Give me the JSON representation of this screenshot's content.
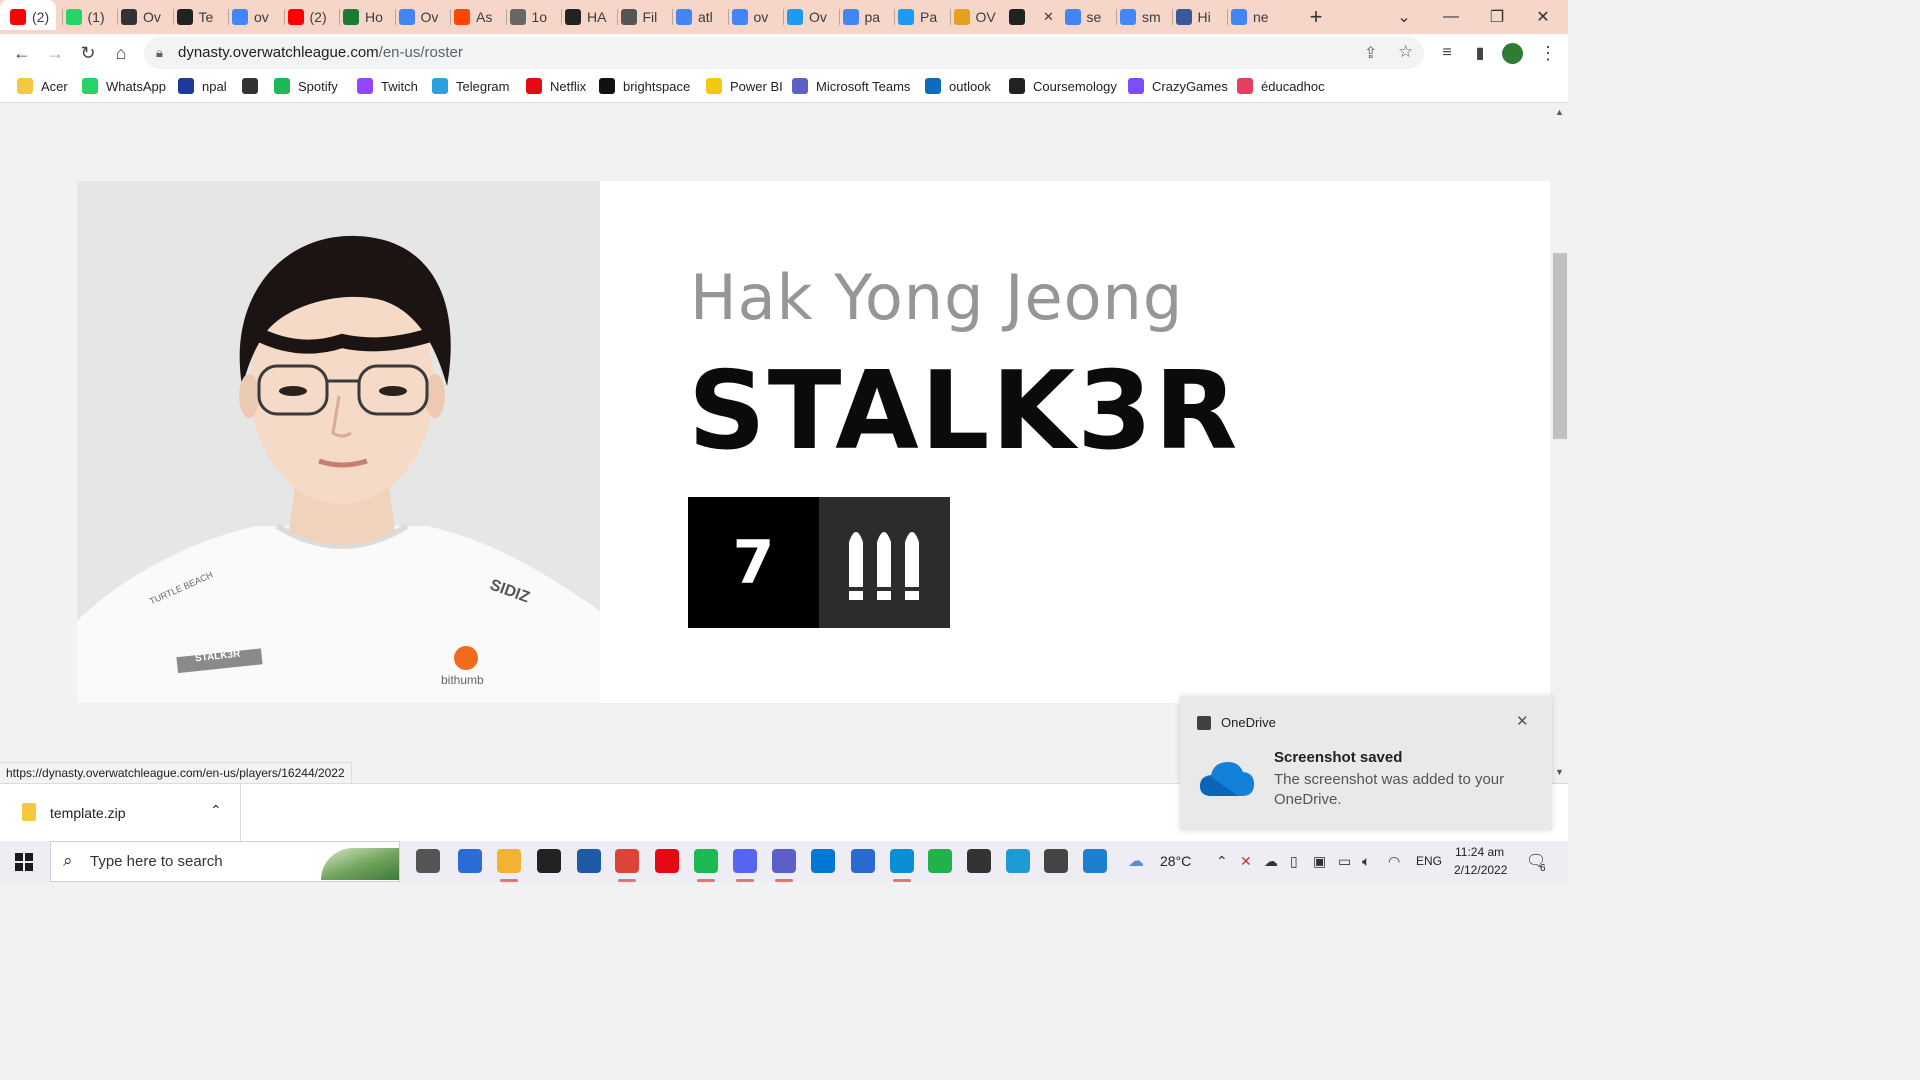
{
  "browser": {
    "tabs": [
      {
        "title": "(2)",
        "icon": "youtube-icon",
        "color": "#ff0000"
      },
      {
        "title": "(1)",
        "icon": "whatsapp-icon",
        "color": "#25d366"
      },
      {
        "title": "Ov",
        "icon": "overwatch-icon",
        "color": "#333333"
      },
      {
        "title": "Te",
        "icon": "dynasty-icon",
        "color": "#222222"
      },
      {
        "title": "ov",
        "icon": "google-icon",
        "color": "#4285f4"
      },
      {
        "title": "(2)",
        "icon": "youtube-icon",
        "color": "#ff0000"
      },
      {
        "title": "Ho",
        "icon": "wiki-w-icon",
        "color": "#1b7a35"
      },
      {
        "title": "Ov",
        "icon": "google-icon",
        "color": "#4285f4"
      },
      {
        "title": "As",
        "icon": "reddit-icon",
        "color": "#ff4500"
      },
      {
        "title": "1o",
        "icon": "globe-icon",
        "color": "#666666"
      },
      {
        "title": "HA",
        "icon": "dynasty-icon",
        "color": "#222222"
      },
      {
        "title": "Fil",
        "icon": "file-icon",
        "color": "#555555"
      },
      {
        "title": "atl",
        "icon": "google-icon",
        "color": "#4285f4"
      },
      {
        "title": "ov",
        "icon": "google-icon",
        "color": "#4285f4"
      },
      {
        "title": "Ov",
        "icon": "twitter-icon",
        "color": "#1d9bf0"
      },
      {
        "title": "pa",
        "icon": "google-icon",
        "color": "#4285f4"
      },
      {
        "title": "Pa",
        "icon": "twitter-icon",
        "color": "#1d9bf0"
      },
      {
        "title": "OV",
        "icon": "coin-icon",
        "color": "#e5a021"
      },
      {
        "title": "",
        "icon": "dynasty-icon",
        "color": "#222222",
        "active": true
      },
      {
        "title": "se",
        "icon": "google-icon",
        "color": "#4285f4"
      },
      {
        "title": "sm",
        "icon": "google-icon",
        "color": "#4285f4"
      },
      {
        "title": "Hi",
        "icon": "globe-icon",
        "color": "#3b5998"
      },
      {
        "title": "ne",
        "icon": "google-icon",
        "color": "#4285f4"
      }
    ],
    "new_tab": "+",
    "url": {
      "host": "dynasty.overwatchleague.com",
      "path": "/en-us/roster"
    },
    "bookmarks": [
      {
        "label": "Acer",
        "icon": "folder-icon",
        "color": "#f5c842"
      },
      {
        "label": "WhatsApp",
        "icon": "whatsapp-icon",
        "color": "#25d366"
      },
      {
        "label": "npal",
        "icon": "npal-icon",
        "color": "#1a3a9c"
      },
      {
        "label": "",
        "icon": "globe-icon",
        "color": "#333333"
      },
      {
        "label": "Spotify",
        "icon": "spotify-icon",
        "color": "#1db954"
      },
      {
        "label": "Twitch",
        "icon": "twitch-icon",
        "color": "#9146ff"
      },
      {
        "label": "Telegram",
        "icon": "telegram-icon",
        "color": "#2aa1da"
      },
      {
        "label": "Netflix",
        "icon": "netflix-icon",
        "color": "#e50914"
      },
      {
        "label": "brightspace",
        "icon": "np-icon",
        "color": "#111111"
      },
      {
        "label": "Power BI",
        "icon": "powerbi-icon",
        "color": "#f2c811"
      },
      {
        "label": "Microsoft Teams",
        "icon": "teams-icon",
        "color": "#5b5fc7"
      },
      {
        "label": "outlook",
        "icon": "outlook-icon",
        "color": "#0f6cbd"
      },
      {
        "label": "Coursemology",
        "icon": "coursemology-icon",
        "color": "#222222"
      },
      {
        "label": "CrazyGames",
        "icon": "crazygames-icon",
        "color": "#7b4dff"
      },
      {
        "label": "éducadhoc",
        "icon": "educadhoc-icon",
        "color": "#e4405f"
      }
    ]
  },
  "player": {
    "real_name": "Hak Yong Jeong",
    "handle": "STALK3R",
    "number": "7",
    "role_icon": "damage-role-icon",
    "jersey_tag": "STALK3R",
    "jersey_sponsor": "SIDIZ",
    "jersey_brand": "bithumb",
    "jersey_club": "TURTLE BEACH"
  },
  "status_bar": {
    "link": "https://dynasty.overwatchleague.com/en-us/players/16244/2022"
  },
  "downloads": {
    "file": "template.zip"
  },
  "toast": {
    "app": "OneDrive",
    "title": "Screenshot saved",
    "body": "The screenshot was added to your OneDrive."
  },
  "taskbar": {
    "search_placeholder": "Type here to search",
    "weather": "28°C",
    "language": "ENG",
    "time": "11:24 am",
    "date": "2/12/2022",
    "notification_count": "6"
  }
}
